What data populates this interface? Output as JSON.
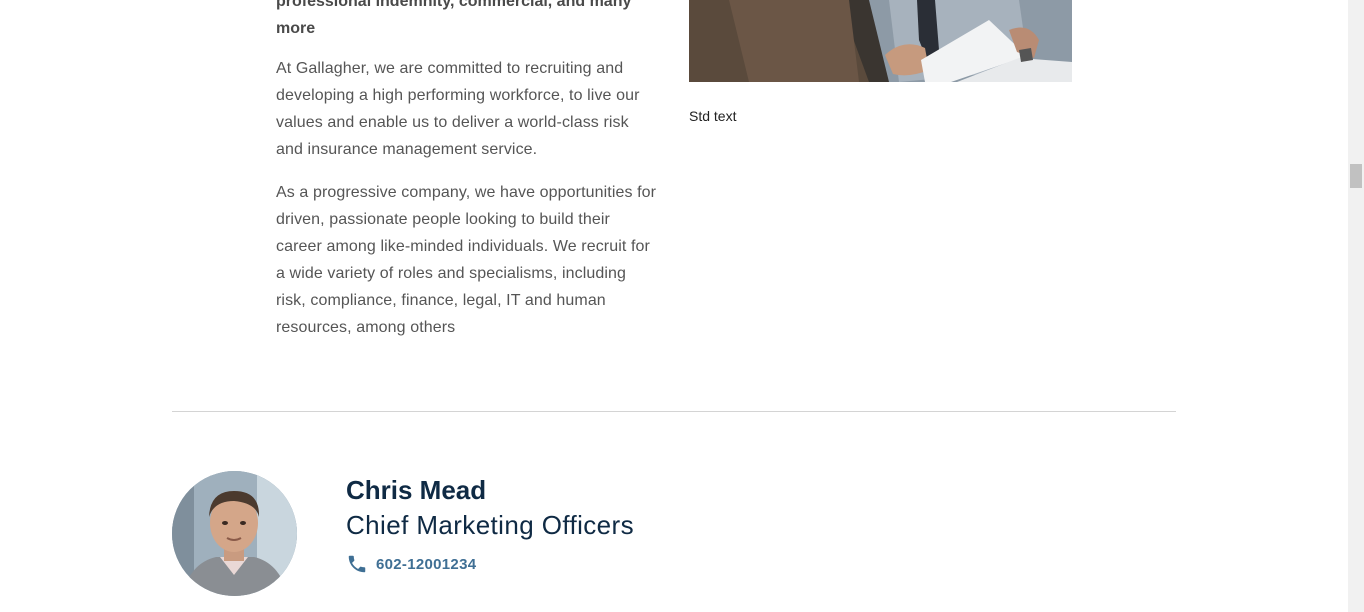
{
  "intro": {
    "lead": "professional indemnity, commercial, and many more",
    "paragraphs": [
      "At Gallagher, we are committed to recruiting and developing a high performing workforce, to live our values and enable us to deliver a world-class risk and insurance management service.",
      "As a progressive company, we have opportunities for driven, passionate people looking to build their career among like-minded individuals. We recruit for a wide variety of roles and specialisms, including risk, compliance, finance, legal, IT and human resources, among others"
    ]
  },
  "media": {
    "caption": "Std text"
  },
  "contact_card": {
    "name": "Chris Mead",
    "title": "Chief Marketing Officers",
    "phone": "602-12001234",
    "phone_icon": "phone-icon"
  },
  "colors": {
    "heading": "#0f2a44",
    "link": "#3f6f94",
    "body_text": "#555555"
  }
}
